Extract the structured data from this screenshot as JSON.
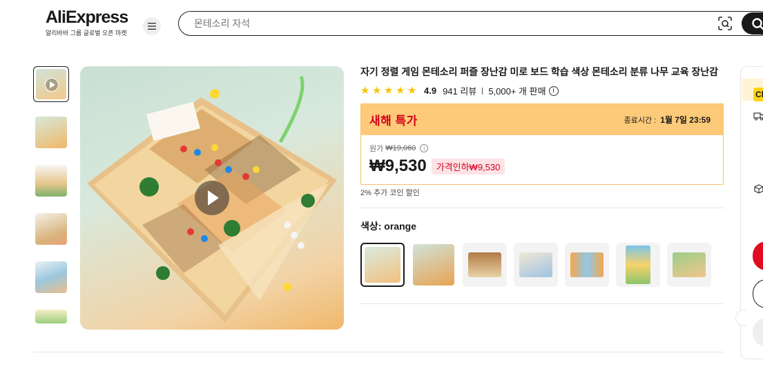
{
  "header": {
    "logo_text": "AliExpress",
    "logo_sub": "알리바바 그룹 글로벌 오픈 마켓",
    "search_placeholder": "몬테소리 자석"
  },
  "product": {
    "title": "자기 정렬 게임 몬테소리 퍼즐 장난감 미로 보드 학습 색상 몬테소리 분류 나무 교육 장난감",
    "rating": "4.9",
    "reviews": "941 리뷰",
    "sold": "5,000+ 개 판매",
    "promo": {
      "name": "새해 특가",
      "end_label": "종료시간 :",
      "end_time": "1월 7일 23:59",
      "original_label": "원가",
      "original_price": "₩19,060",
      "price": "₩9,530",
      "discount": "가격인하₩9,530",
      "coin": "2% 추가 코인 할인"
    },
    "color_label": "색상: orange",
    "swatch_count": 7
  },
  "side": {
    "tag": "Ch"
  },
  "colors": {
    "brand_red": "#e00c1f",
    "promo_bg": "#fdca79",
    "promo_text": "#d4001b",
    "star": "#fac400"
  }
}
